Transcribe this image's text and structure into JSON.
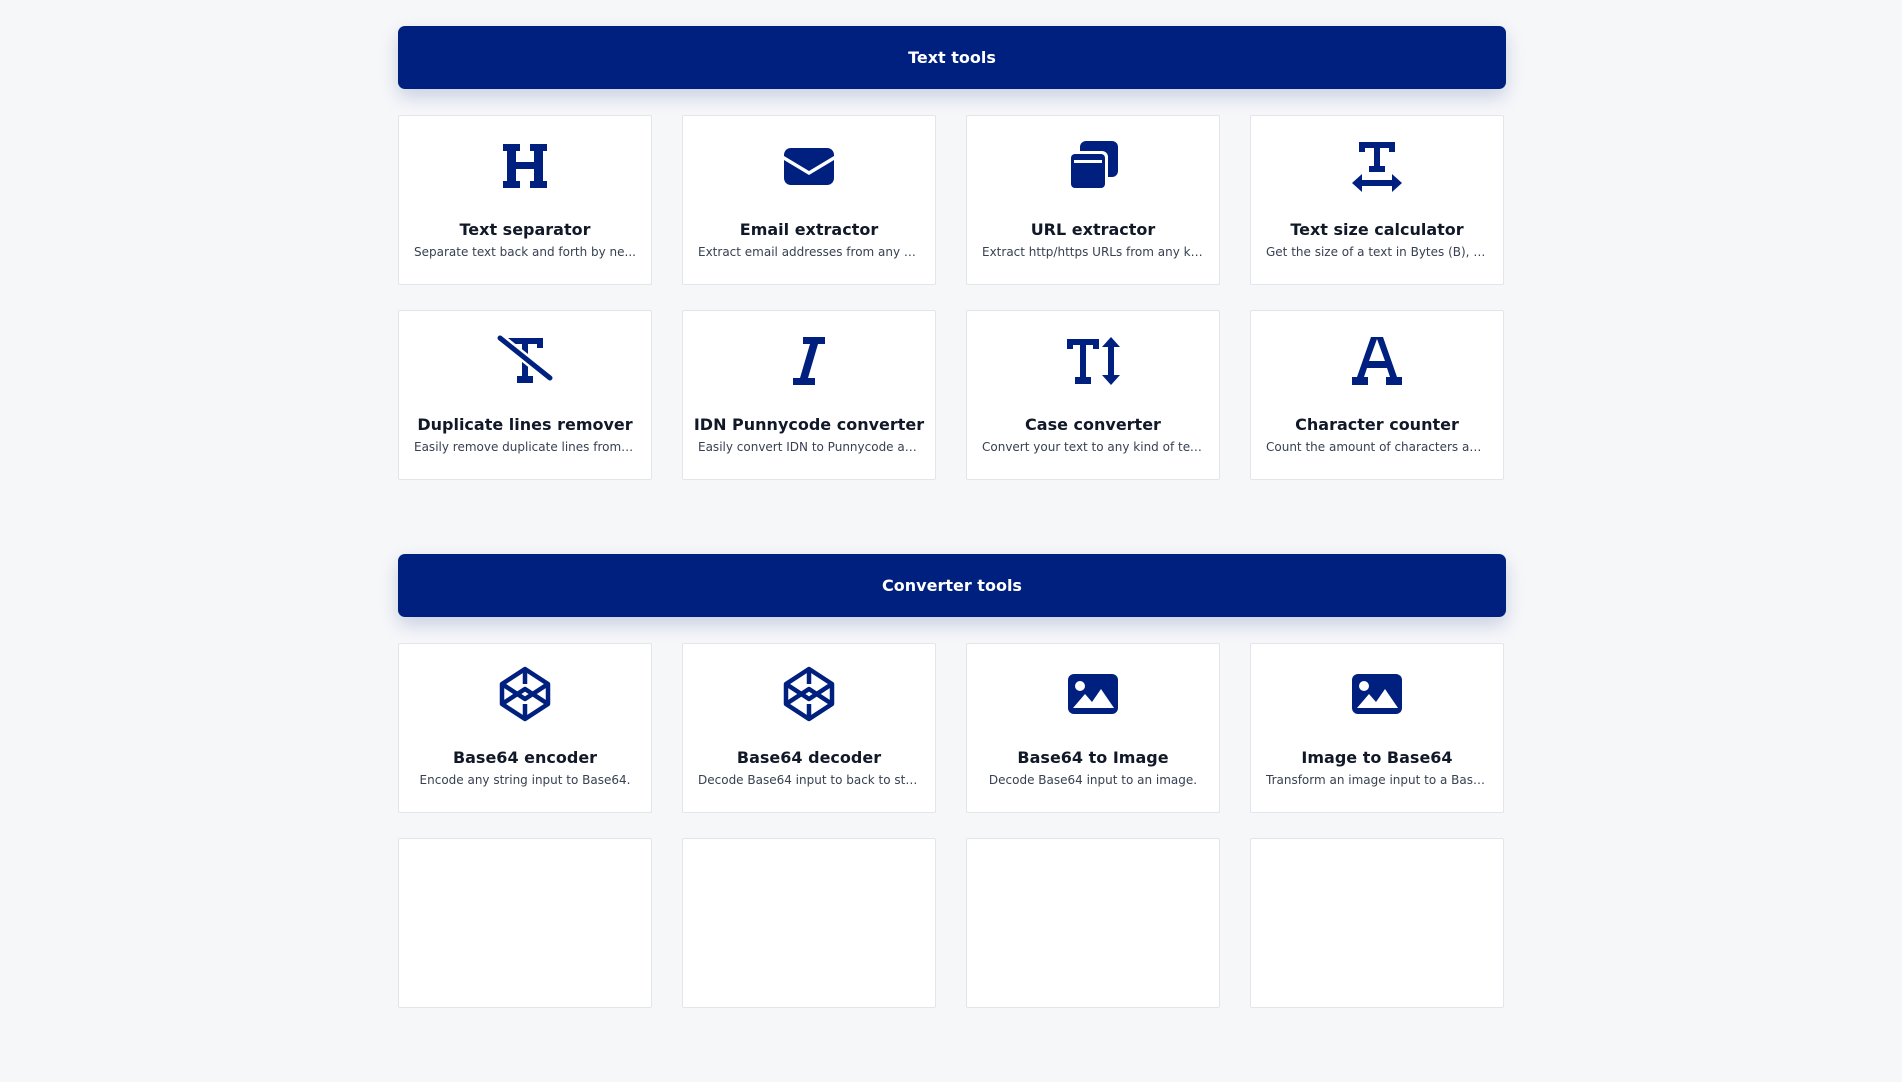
{
  "sections": [
    {
      "title": "Text tools",
      "tools": [
        {
          "title": "Text separator",
          "desc": "Separate text back and forth by ne...",
          "icon": "heading-icon"
        },
        {
          "title": "Email extractor",
          "desc": "Extract email addresses from any ki...",
          "icon": "envelope-icon"
        },
        {
          "title": "URL extractor",
          "desc": "Extract http/https URLs from any ki...",
          "icon": "window-restore-icon"
        },
        {
          "title": "Text size calculator",
          "desc": "Get the size of a text in Bytes (B), Kil...",
          "icon": "text-width-icon"
        },
        {
          "title": "Duplicate lines remover",
          "desc": "Easily remove duplicate lines from a...",
          "icon": "remove-format-icon"
        },
        {
          "title": "IDN Punnycode converter",
          "desc": "Easily convert IDN to Punnycode an...",
          "icon": "italic-icon"
        },
        {
          "title": "Case converter",
          "desc": "Convert your text to any kind of tex...",
          "icon": "text-height-icon"
        },
        {
          "title": "Character counter",
          "desc": "Count the amount of characters an...",
          "icon": "font-icon"
        }
      ]
    },
    {
      "title": "Converter tools",
      "tools": [
        {
          "title": "Base64 encoder",
          "desc": "Encode any string input to Base64.",
          "icon": "codepen-icon"
        },
        {
          "title": "Base64 decoder",
          "desc": "Decode Base64 input to back to stri...",
          "icon": "codepen-icon"
        },
        {
          "title": "Base64 to Image",
          "desc": "Decode Base64 input to an image.",
          "icon": "image-icon"
        },
        {
          "title": "Image to Base64",
          "desc": "Transform an image input to a Base...",
          "icon": "image-icon"
        }
      ]
    }
  ],
  "colors": {
    "accent": "#00207f",
    "background": "#f6f7f9",
    "card": "#ffffff"
  }
}
